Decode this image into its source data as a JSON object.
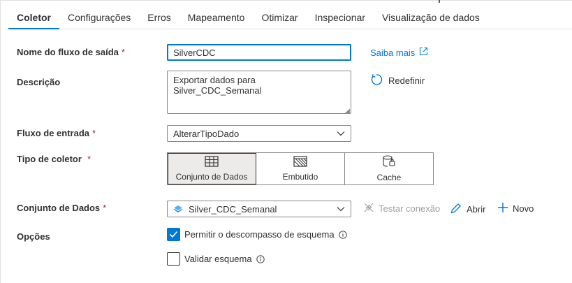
{
  "tabs": [
    {
      "label": "Coletor",
      "active": true
    },
    {
      "label": "Configurações"
    },
    {
      "label": "Erros"
    },
    {
      "label": "Mapeamento"
    },
    {
      "label": "Otimizar"
    },
    {
      "label": "Inspecionar"
    },
    {
      "label": "Visualização de dados"
    }
  ],
  "form": {
    "output_stream_label": "Nome do fluxo de saída",
    "output_stream_value": "SilverCDC",
    "learn_more": "Saiba mais",
    "description_label": "Descrição",
    "description_value": "Exportar dados para Silver_CDC_Semanal",
    "reset_label": "Redefinir",
    "input_stream_label": "Fluxo de entrada",
    "input_stream_value": "AlterarTipoDado",
    "sink_type_label": "Tipo de coletor",
    "sink_types": [
      {
        "label": "Conjunto de Dados",
        "icon": "table-icon",
        "selected": true
      },
      {
        "label": "Embutido",
        "icon": "inline-hatched-icon"
      },
      {
        "label": "Cache",
        "icon": "cache-icon"
      }
    ],
    "dataset_label": "Conjunto de Dados",
    "dataset_value": "Silver_CDC_Semanal",
    "test_connection": "Testar conexão",
    "open_label": "Abrir",
    "new_label": "Novo",
    "options_label": "Opções",
    "allow_schema_drift": "Permitir o descompasso de esquema",
    "allow_schema_drift_checked": true,
    "validate_schema": "Validar esquema",
    "validate_schema_checked": false,
    "required_marker": "*"
  },
  "colors": {
    "accent": "#0078d4",
    "required": "#a4262c"
  }
}
